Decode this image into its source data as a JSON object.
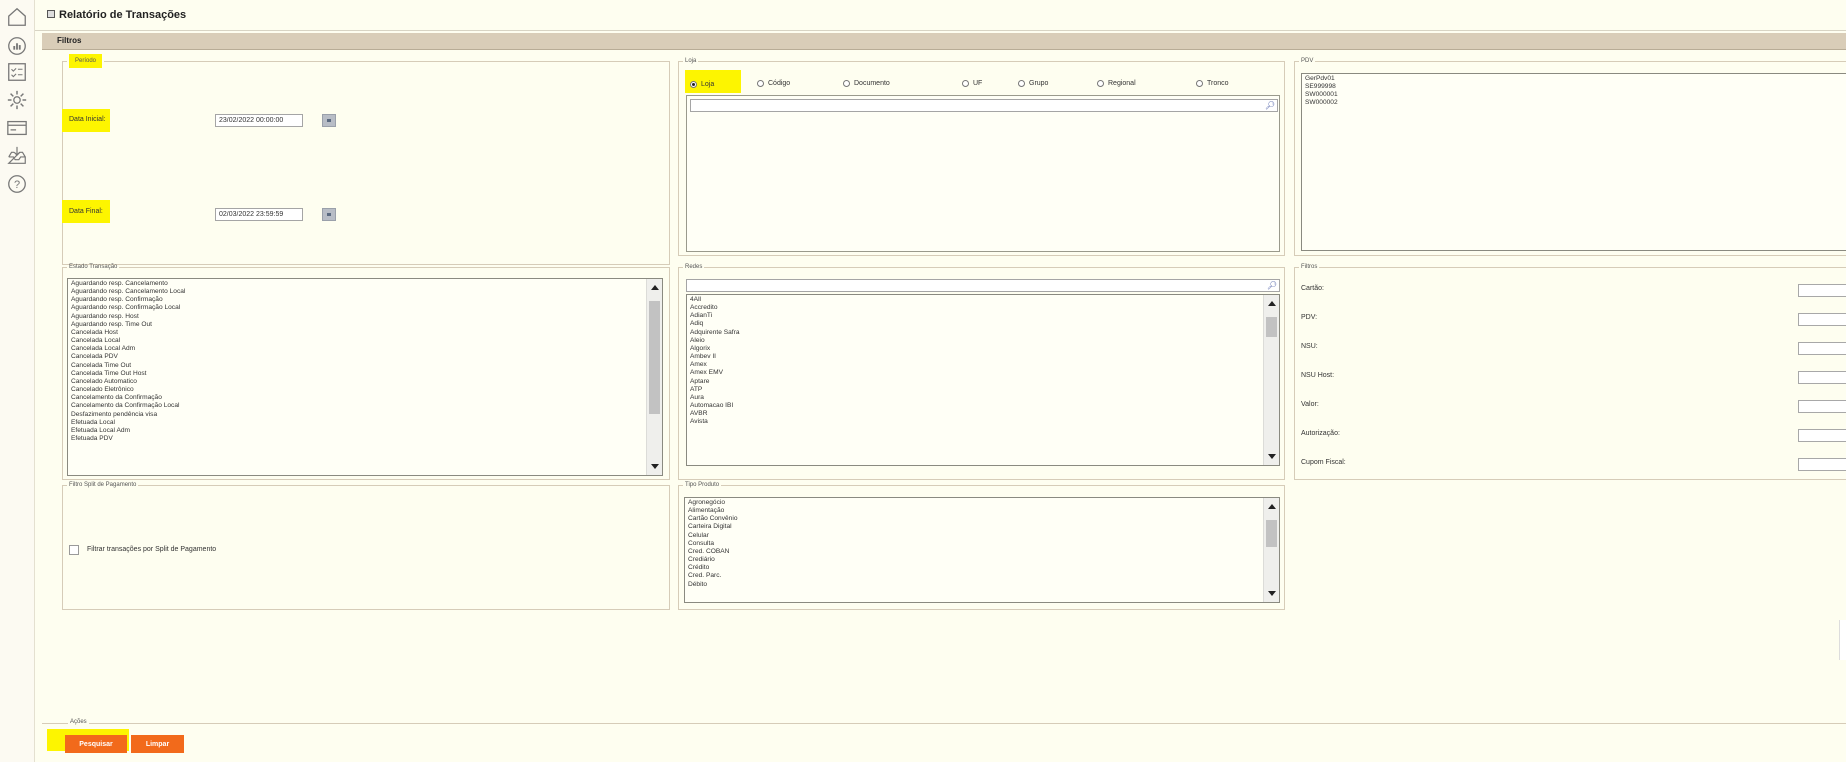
{
  "app": {
    "title": "Relatório de Transações"
  },
  "filters_header": "Filtros",
  "periodo": {
    "legend": "Período",
    "start_label": "Data Inicial:",
    "start_value": "23/02/2022 00:00:00",
    "end_label": "Data Final:",
    "end_value": "02/03/2022 23:59:59"
  },
  "loja": {
    "legend": "Loja",
    "options": [
      "Loja",
      "Código",
      "Documento",
      "UF",
      "Grupo",
      "Regional",
      "Tronco"
    ],
    "selected": "Loja"
  },
  "pdv": {
    "legend": "PDV",
    "items": [
      "GerPdv01",
      "SE999998",
      "SW000001",
      "SW000002"
    ]
  },
  "estado": {
    "legend": "Estado Transação",
    "items": [
      "Aguardando resp. Cancelamento",
      "Aguardando resp. Cancelamento Local",
      "Aguardando resp. Confirmação",
      "Aguardando resp. Confirmação Local",
      "Aguardando resp. Host",
      "Aguardando resp. Time Out",
      "Cancelada Host",
      "Cancelada Local",
      "Cancelada Local Adm",
      "Cancelada PDV",
      "Cancelada Time Out",
      "Cancelada Time Out Host",
      "Cancelado Automatico",
      "Cancelado Eletrônico",
      "Cancelamento da Confirmação",
      "Cancelamento da Confirmação Local",
      "Desfazimento pendência visa",
      "Efetuada Local",
      "Efetuada Local Adm",
      "Efetuada PDV"
    ]
  },
  "redes": {
    "legend": "Redes",
    "items": [
      "4All",
      "Accredito",
      "AdianTi",
      "Adiq",
      "Adquirente Safra",
      "Aleio",
      "Algorix",
      "Ambev II",
      "Amex",
      "Amex EMV",
      "Aptare",
      "ATP",
      "Aura",
      "Automacao IBI",
      "AVBR",
      "Avista"
    ]
  },
  "filtros": {
    "legend": "Filtros",
    "fields": [
      "Cartão:",
      "PDV:",
      "NSU:",
      "NSU Host:",
      "Valor:",
      "Autorização:",
      "Cupom Fiscal:"
    ]
  },
  "split": {
    "legend": "Filtro Split de Pagamento",
    "checkbox_label": "Filtrar transações por Split de Pagamento"
  },
  "tipo_produto": {
    "legend": "Tipo Produto",
    "items": [
      "Agronegócio",
      "Alimentação",
      "Cartão Convênio",
      "Carteira Digital",
      "Celular",
      "Consulta",
      "Cred. COBAN",
      "Crediário",
      "Crédito",
      "Cred. Parc.",
      "Débito"
    ]
  },
  "acoes": {
    "legend": "Ações",
    "search_label": "Pesquisar",
    "clear_label": "Limpar"
  },
  "colors": {
    "accent": "#f26a1b",
    "highlight": "#fdf500",
    "bar": "#d9cdb8",
    "background": "#fefef0"
  },
  "sidebar_icons": [
    "home-icon",
    "dashboard-icon",
    "checklist-icon",
    "gear-icon",
    "card-icon",
    "inbox-download-icon",
    "help-icon"
  ]
}
